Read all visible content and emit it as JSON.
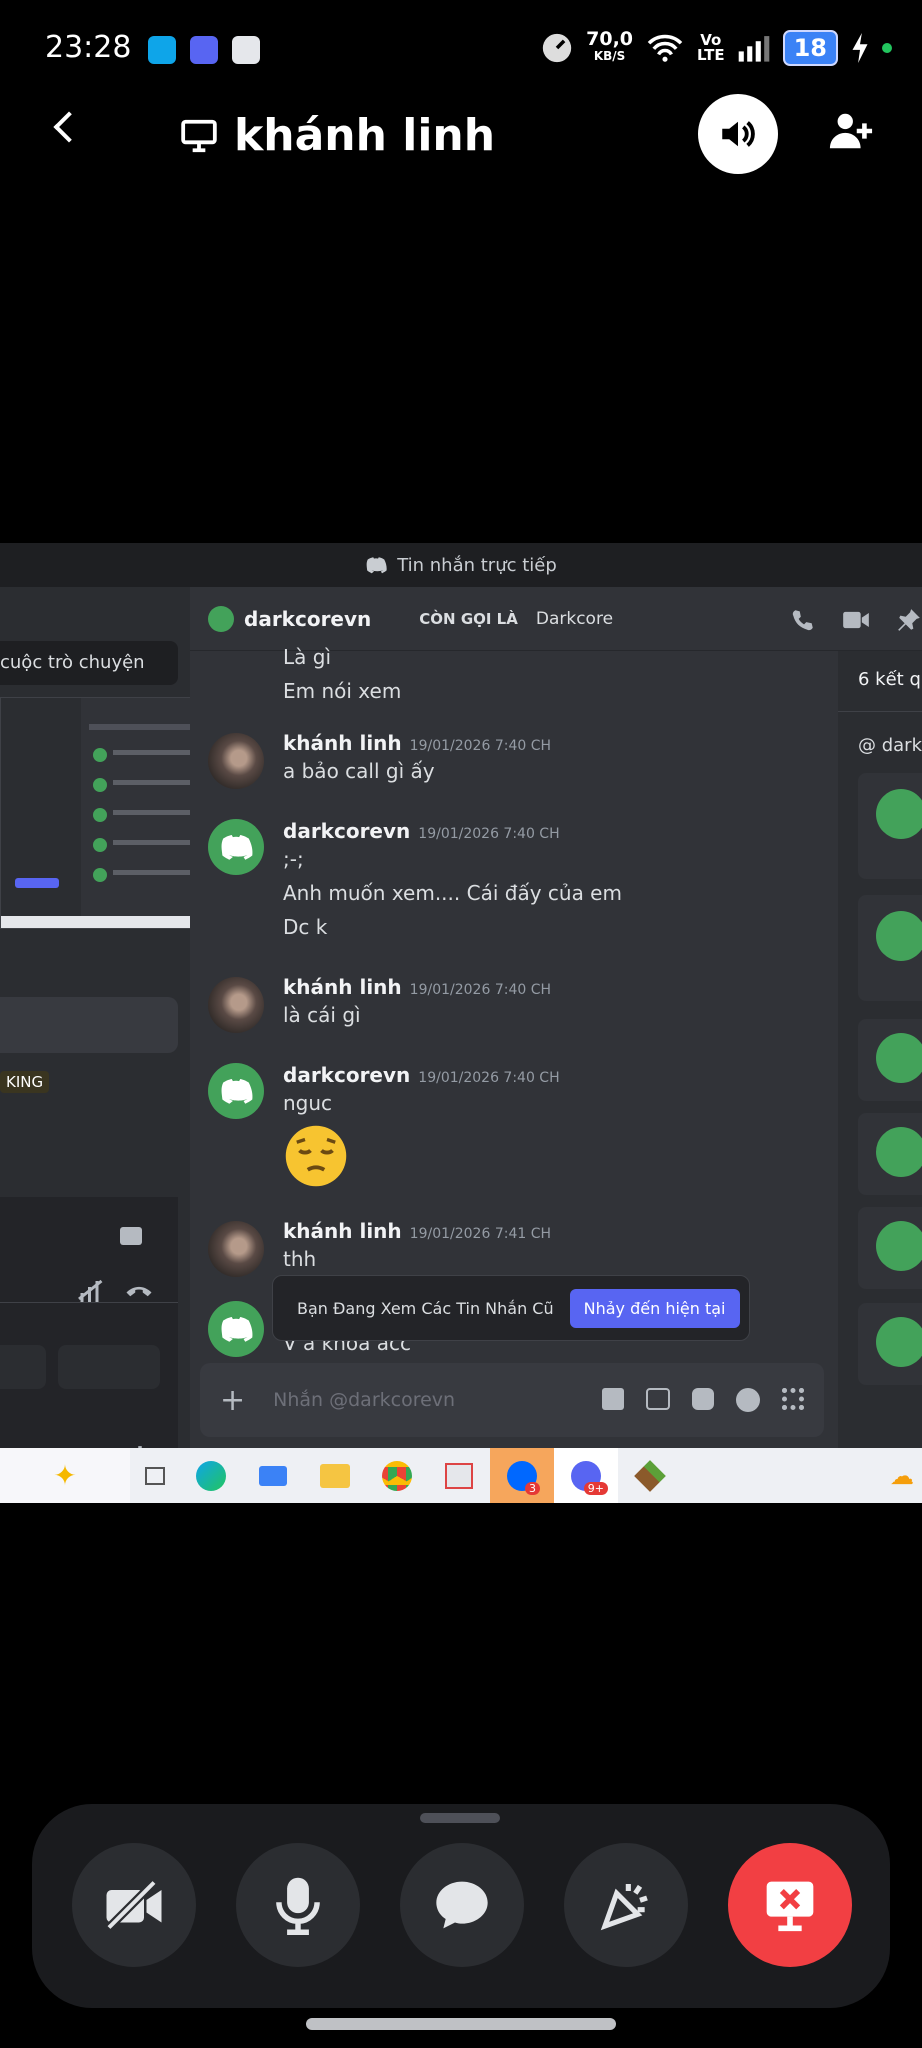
{
  "status_bar": {
    "time": "23:28",
    "net_speed": "70,0",
    "net_unit": "KB/S",
    "volte_top": "Vo",
    "volte_bottom": "LTE",
    "battery": "18"
  },
  "header": {
    "title": "khánh linh",
    "icons": [
      "back-arrow-icon",
      "monitor-icon",
      "speaker-icon",
      "add-user-icon"
    ]
  },
  "shared_screen": {
    "window_title": "Tin nhắn trực tiếp",
    "left_search": "cuộc trò chuyện",
    "left_badge": "KING",
    "channel_name": "darkcorevn",
    "alias_label": "CÒN GỌI LÀ",
    "alias_value": "Darkcore",
    "search_results": "6 kết q",
    "search_query": "@ dark",
    "messages": [
      {
        "author": "",
        "time": "",
        "lines": [
          "Là gì",
          "Em nói xem"
        ]
      },
      {
        "author": "khánh linh",
        "time": "19/01/2026 7:40 CH",
        "lines": [
          "a bảo call gì ấy"
        ]
      },
      {
        "author": "darkcorevn",
        "time": "19/01/2026 7:40 CH",
        "lines": [
          ";-;",
          "Anh muốn xem.... Cái đấy của em",
          "Dc k"
        ]
      },
      {
        "author": "khánh linh",
        "time": "19/01/2026 7:40 CH",
        "lines": [
          "là cái gì"
        ]
      },
      {
        "author": "darkcorevn",
        "time": "19/01/2026 7:40 CH",
        "lines": [
          "nguc"
        ]
      },
      {
        "author": "khánh linh",
        "time": "19/01/2026 7:41 CH",
        "lines": [
          "thh"
        ]
      },
      {
        "author": "",
        "time": "",
        "lines": [
          "V a khoá acc"
        ]
      }
    ],
    "old_messages_text": "Bạn Đang Xem Các Tin Nhắn Cũ",
    "jump_button": "Nhảy đến hiện tại",
    "input_placeholder": "Nhắn @darkcorevn",
    "taskbar_badge_zalo": "3",
    "taskbar_badge_discord": "9+"
  },
  "controls": {
    "buttons": [
      "camera-off-icon",
      "microphone-icon",
      "chat-icon",
      "soundboard-icon",
      "stop-share-icon"
    ],
    "danger_color": "#f23f43"
  }
}
